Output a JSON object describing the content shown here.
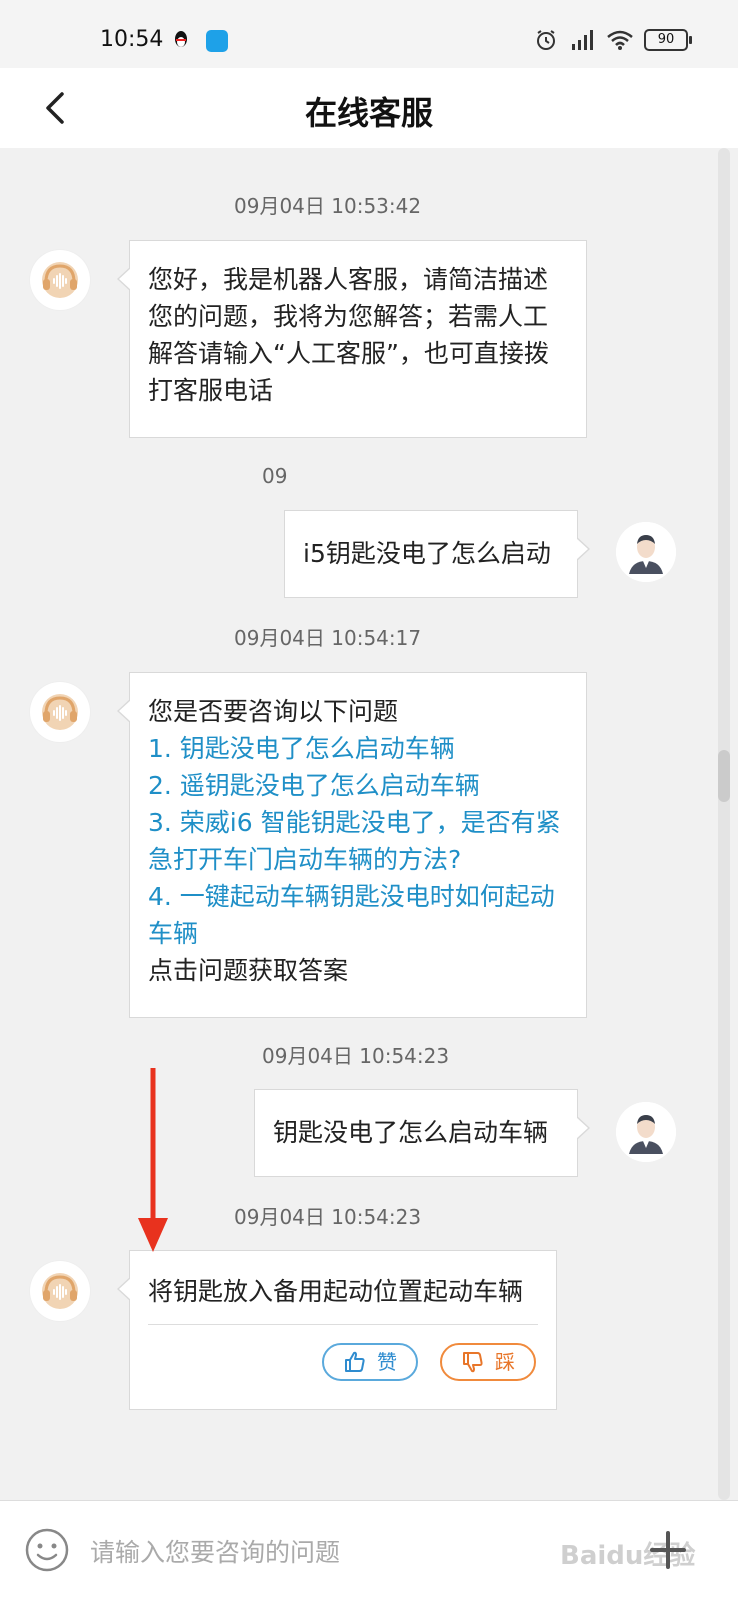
{
  "status_bar": {
    "time": "10:54",
    "battery": "90"
  },
  "header": {
    "title": "在线客服"
  },
  "messages": {
    "m1": {
      "timestamp": "09月04日 10:53:42",
      "text": "您好，我是机器人客服，请简洁描述您的问题，我将为您解答；若需人工解答请输入“人工客服”，也可直接拨打客服电话"
    },
    "m2": {
      "timestamp": "09",
      "text": "i5钥匙没电了怎么启动"
    },
    "m3": {
      "timestamp": "09月04日 10:54:17",
      "intro": "您是否要咨询以下问题",
      "options": [
        "1. 钥匙没电了怎么启动车辆",
        "2. 遥钥匙没电了怎么启动车辆",
        "3. 荣威i6 智能钥匙没电了，是否有紧急打开车门启动车辆的方法?",
        "4. 一键起动车辆钥匙没电时如何起动车辆"
      ],
      "outro": "点击问题获取答案"
    },
    "m4": {
      "timestamp": "09月04日 10:54:23",
      "text": "钥匙没电了怎么启动车辆"
    },
    "m5": {
      "timestamp": "09月04日 10:54:23",
      "text": "将钥匙放入备用起动位置起动车辆",
      "like_label": "赞",
      "dislike_label": "踩"
    }
  },
  "input": {
    "placeholder": "请输入您要咨询的问题"
  },
  "watermark": "Baidu经验",
  "colors": {
    "link": "#1f8fc7",
    "arrow": "#e8321e",
    "bot_icon": "#e8b98a"
  },
  "icons": [
    "back-arrow-icon",
    "qq-icon",
    "app-icon",
    "alarm-icon",
    "signal-icon",
    "wifi-icon",
    "battery-icon",
    "headset-icon",
    "user-avatar-icon",
    "thumbs-up-icon",
    "thumbs-down-icon",
    "emoji-icon",
    "plus-icon"
  ]
}
